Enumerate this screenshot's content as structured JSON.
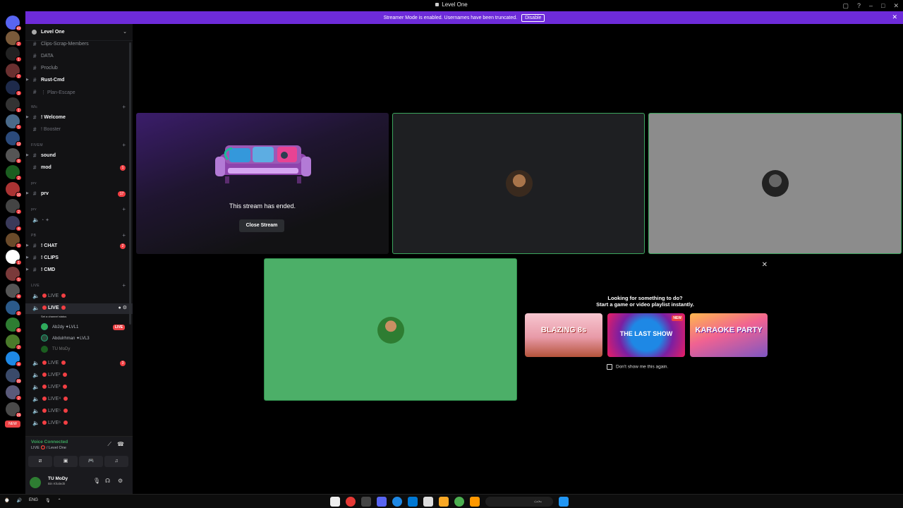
{
  "window": {
    "title": "Level One"
  },
  "banner": {
    "text": "Streamer Mode is enabled. Usernames have been truncated.",
    "disable_label": "Disable"
  },
  "guild": {
    "name": "Level One"
  },
  "channels": [
    {
      "type": "text",
      "label": "Clips-Scrap-Members",
      "style": "normal"
    },
    {
      "type": "text",
      "label": "DATA",
      "style": "normal"
    },
    {
      "type": "text",
      "label": "Proclub",
      "style": "normal"
    },
    {
      "type": "text",
      "label": "Rust-Cmd",
      "style": "bold",
      "arrow": true
    },
    {
      "type": "text",
      "label": "⋮ Plan-Escape",
      "style": "dim"
    },
    {
      "type": "category",
      "label": "Wlc"
    },
    {
      "type": "text",
      "label": "! Welcome",
      "style": "bold",
      "arrow": true
    },
    {
      "type": "text",
      "label": "! Booster",
      "style": "dim"
    },
    {
      "type": "category",
      "label": "FIVEM"
    },
    {
      "type": "text",
      "label": "sound",
      "style": "bold",
      "arrow": true
    },
    {
      "type": "text",
      "label": "mod",
      "style": "bold",
      "badge": "1"
    },
    {
      "type": "category",
      "label": "prv"
    },
    {
      "type": "text",
      "label": "prv",
      "style": "bold",
      "arrow": true,
      "badge": "17"
    },
    {
      "type": "category",
      "label": "prv"
    },
    {
      "type": "voice",
      "label": "",
      "style": "dim"
    },
    {
      "type": "category",
      "label": "PB"
    },
    {
      "type": "text",
      "label": "! CHAT",
      "style": "bold",
      "arrow": true,
      "badge": "2"
    },
    {
      "type": "text",
      "label": "! CLIPS",
      "style": "bold",
      "arrow": true
    },
    {
      "type": "text",
      "label": "! CMD",
      "style": "bold",
      "arrow": true
    },
    {
      "type": "category",
      "label": "LIVE"
    },
    {
      "type": "voice",
      "label": "LIVE",
      "style": "normal"
    },
    {
      "type": "voice",
      "label": "LIVE",
      "style": "bold",
      "active": true
    }
  ],
  "channel_status_hint": "Set a channel status",
  "voice_users": [
    {
      "name": "Ab2dy",
      "tag": "LVL1",
      "live": true,
      "live_label": "LIVE"
    },
    {
      "name": "Abdulrhman",
      "tag": "LVL3",
      "live": false
    },
    {
      "name": "TU MoDy",
      "tag": "",
      "live": false
    }
  ],
  "live_channels": [
    {
      "label": "LIVE",
      "badge": "3"
    },
    {
      "label": "LIVE²"
    },
    {
      "label": "LIVE³"
    },
    {
      "label": "LIVE⁴"
    },
    {
      "label": "LIVE⁵"
    },
    {
      "label": "LIVE⁶"
    }
  ],
  "voice_panel": {
    "status": "Voice Connected",
    "channel": "LIVE ⭕ / Level One"
  },
  "user_panel": {
    "name": "TU MoDy",
    "status": "Bin Khaled0"
  },
  "stream": {
    "ended_text": "This stream has ended.",
    "close_label": "Close Stream"
  },
  "activity": {
    "heading1": "Looking for something to do?",
    "heading2": "Start a game or video playlist instantly.",
    "games": [
      {
        "title": "BLAZING 8s",
        "new": false
      },
      {
        "title": "THE LAST SHOW",
        "new": true,
        "new_label": "NEW"
      },
      {
        "title": "KARAOKE PARTY",
        "new": false
      }
    ],
    "dont_show": "Don't show me this again."
  },
  "taskbar": {
    "lang": "ENG",
    "search_placeholder": "بحث"
  },
  "colors": {
    "banner": "#6d2bd9",
    "speaking": "#3ba55d",
    "live": "#ed4245",
    "green_tile": "#4caf68"
  }
}
